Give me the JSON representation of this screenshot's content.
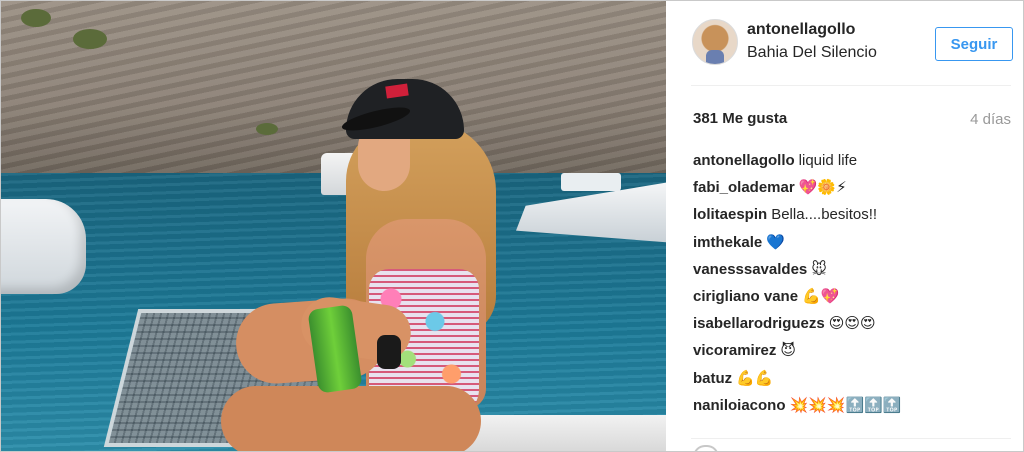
{
  "post": {
    "username": "antonellagollo",
    "location": "Bahia Del Silencio",
    "follow_label": "Seguir",
    "likes": "381 Me gusta",
    "time": "4 días"
  },
  "comments": [
    {
      "user": "antonellagollo",
      "text": "liquid life"
    },
    {
      "user": "fabi_olademar",
      "text": "💖🌼⚡"
    },
    {
      "user": "lolitaespin",
      "text": "Bella....besitos!!"
    },
    {
      "user": "imthekale",
      "text": "💙"
    },
    {
      "user": "vanesssavaldes",
      "text": "🐭"
    },
    {
      "user": "cirigliano vane",
      "text": "💪💖"
    },
    {
      "user": "isabellarodriguezs",
      "text": "😍😍😍"
    },
    {
      "user": "vicoramirez",
      "text": "😈"
    },
    {
      "user": "batuz",
      "text": "💪💪"
    },
    {
      "user": "naniloiacono",
      "text": "💥💥💥🔝🔝🔝"
    }
  ],
  "icons": {
    "like": "heart-icon"
  }
}
